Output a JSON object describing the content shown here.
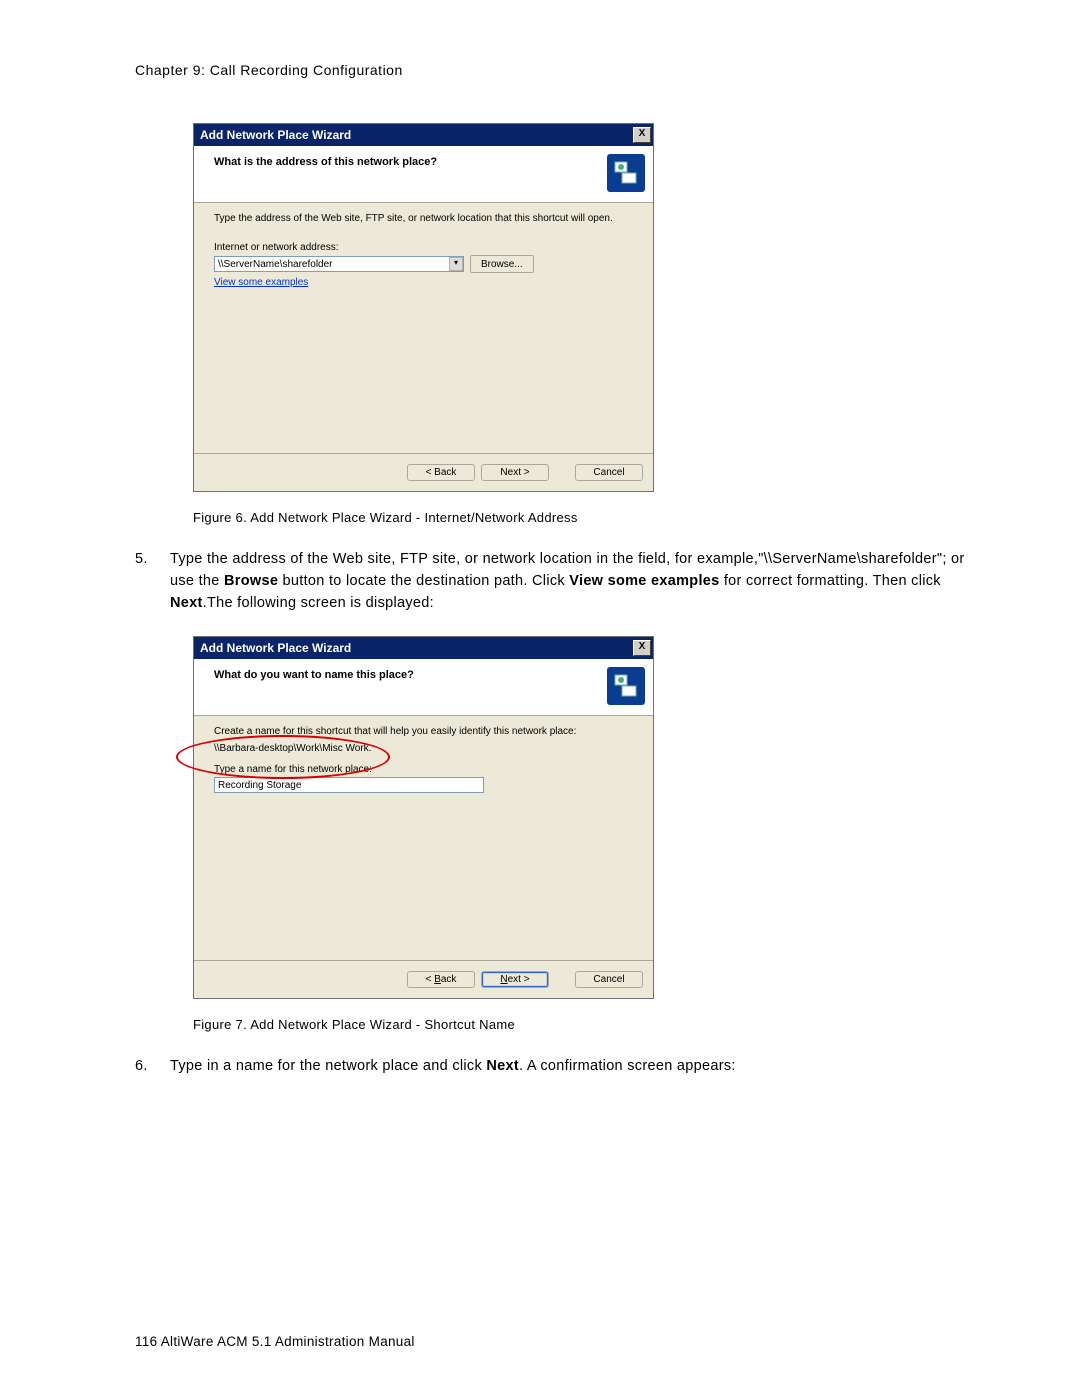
{
  "chapter_header": "Chapter 9:  Call Recording Configuration",
  "wizard1": {
    "title": "Add Network Place Wizard",
    "close": "X",
    "heading": "What is the address of this network place?",
    "desc": "Type the address of the Web site, FTP site, or network location that this shortcut will open.",
    "label": "Internet or network address:",
    "input_value": "\\\\ServerName\\sharefolder",
    "browse": "Browse...",
    "examples_link": "View some examples",
    "back": "< Back",
    "next": "Next >",
    "cancel": "Cancel"
  },
  "caption1": "Figure 6.   Add Network Place Wizard - Internet/Network Address",
  "step5": {
    "num": "5.",
    "text_a": "Type the address of the Web site, FTP site, or network location in the field, for example,\"\\\\ServerName\\sharefolder\"; or use the ",
    "bold_a": "Browse",
    "text_b": " button to locate the destination path. Click ",
    "bold_b": "View some examples",
    "text_c": " for correct formatting. Then click ",
    "bold_c": "Next",
    "text_d": ".The following screen is displayed:"
  },
  "wizard2": {
    "title": "Add Network Place Wizard",
    "close": "X",
    "heading": "What do you want to name this place?",
    "desc": "Create a name for this shortcut that will help you easily identify this network place:",
    "path": "\\\\Barbara-desktop\\Work\\Misc Work.",
    "label_pre": "T",
    "label_post": "ype a name for this network place:",
    "input_value": "Recording Storage",
    "back_pre": "< ",
    "back_u": "B",
    "back_post": "ack",
    "next_u": "N",
    "next_post": "ext >",
    "cancel": "Cancel"
  },
  "caption2": "Figure 7.   Add Network Place Wizard - Shortcut Name",
  "step6": {
    "num": "6.",
    "text_a": "Type in a name for the network place and click ",
    "bold_a": "Next",
    "text_b": ". A confirmation screen appears:"
  },
  "footer": "116   AltiWare ACM 5.1 Administration Manual"
}
